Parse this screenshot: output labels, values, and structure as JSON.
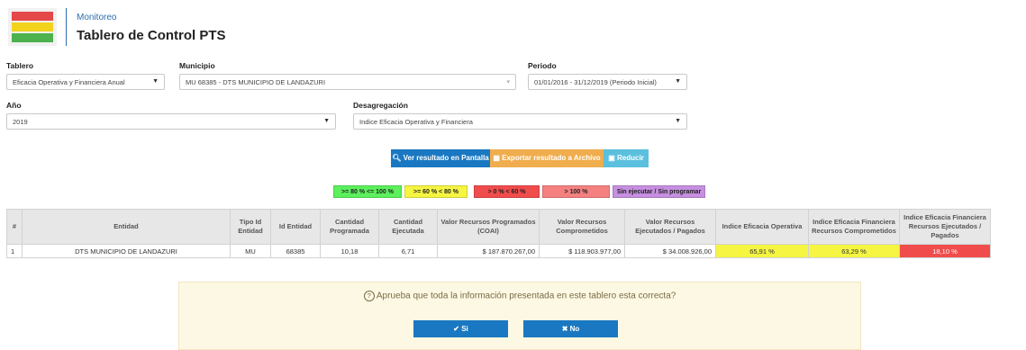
{
  "header": {
    "breadcrumb": "Monitoreo",
    "title": "Tablero de Control PTS"
  },
  "form": {
    "tablero": {
      "label": "Tablero",
      "value": "Eficacia Operativa y Financiera Anual"
    },
    "municipio": {
      "label": "Municipio",
      "value": "MU 68385 - DTS MUNICIPIO DE LANDAZURI"
    },
    "periodo": {
      "label": "Periodo",
      "value": "01/01/2016 - 31/12/2019 (Periodo Inicial)"
    },
    "anio": {
      "label": "Año",
      "value": "2019"
    },
    "desagregacion": {
      "label": "Desagregación",
      "value": "Indice Eficacia Operativa y Financiera"
    }
  },
  "actions": {
    "view": "Ver resultado en Pantalla",
    "export": "Exportar resultado a Archivo",
    "reduce": "Reducir"
  },
  "legend": [
    {
      "label": ">= 80 % <= 100 %",
      "color": "#5cf05c"
    },
    {
      "label": ">= 60 % < 80 %",
      "color": "#f5f542"
    },
    {
      "label": "> 0 % < 60 %",
      "color": "#f14c4c"
    },
    {
      "label": "> 100 %",
      "color": "#f58080"
    },
    {
      "label": "Sin ejecutar / Sin programar",
      "color": "#c68fe0"
    }
  ],
  "table": {
    "headers": [
      "#",
      "Entidad",
      "Tipo Id Entidad",
      "Id Entidad",
      "Cantidad Programada",
      "Cantidad Ejecutada",
      "Valor Recursos Programados (COAI)",
      "Valor Recursos Comprometidos",
      "Valor Recursos Ejecutados / Pagados",
      "Indice Eficacia Operativa",
      "Indice Eficacia Financiera Recursos Comprometidos",
      "Indice Eficacia Financiera Recursos Ejecutados / Pagados"
    ],
    "rows": [
      [
        "1",
        "DTS MUNICIPIO DE LANDAZURI",
        "MU",
        "68385",
        "10,18",
        "6,71",
        "$ 187.870.267,00",
        "$ 118.903.977,00",
        "$ 34.008.926,00",
        "65,91 %",
        "63,29 %",
        "18,10 %"
      ]
    ]
  },
  "dialog": {
    "question": "Aprueba que toda la información presentada en este tablero esta correcta?",
    "yes": "Si",
    "no": "No"
  }
}
